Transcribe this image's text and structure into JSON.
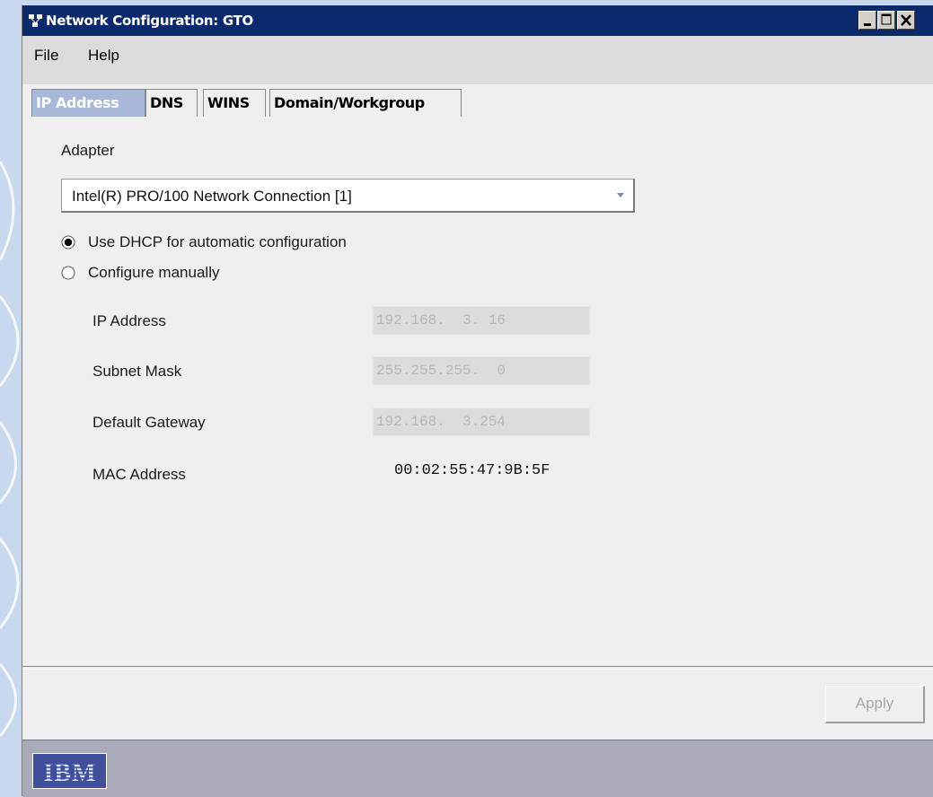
{
  "window": {
    "title": "Network Configuration: GTO",
    "accent": "#0b2a6b",
    "buttons": [
      "minimize-icon",
      "maximize-icon",
      "close-icon"
    ]
  },
  "menu": {
    "file": "File",
    "help": "Help"
  },
  "tabs": [
    "IP Address",
    "DNS",
    "WINS",
    "Domain/Workgroup"
  ],
  "active_tab": "IP Address",
  "adapter": {
    "label": "Adapter",
    "selected": "Intel(R) PRO/100 Network Connection [1]"
  },
  "mode": {
    "dhcp_label": "Use DHCP for automatic configuration",
    "manual_label": "Configure manually",
    "selected": "dhcp"
  },
  "fields": {
    "ip_label": "IP Address",
    "ip_value": "192.168.  3. 16",
    "subnet_label": "Subnet Mask",
    "subnet_value": "255.255.255.  0",
    "gateway_label": "Default Gateway",
    "gateway_value": "192.168.  3.254",
    "mac_label": "MAC Address",
    "mac_value": "00:02:55:47:9B:5F"
  },
  "actions": {
    "apply_label": "Apply"
  },
  "status": {
    "logo_text": "IBM"
  }
}
